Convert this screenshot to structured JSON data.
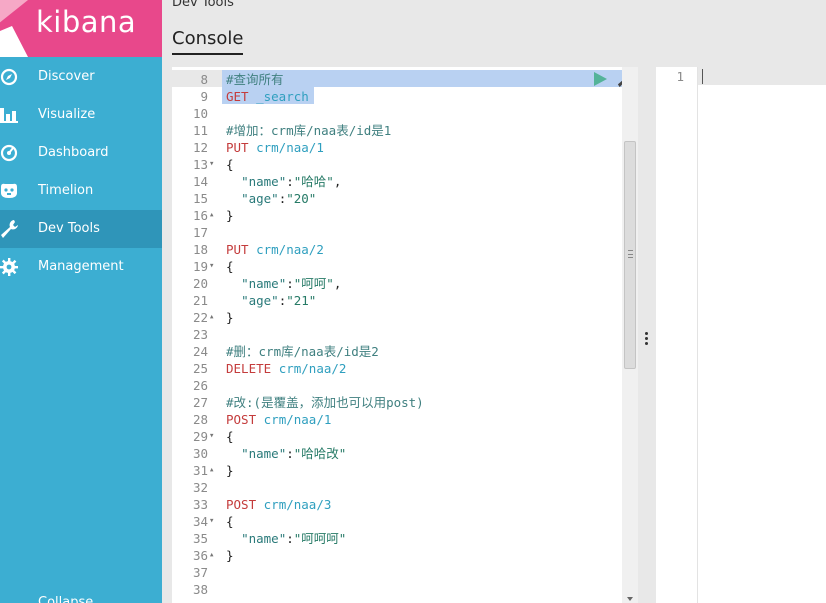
{
  "app": {
    "brand": "kibana",
    "nav": [
      {
        "label": "Discover",
        "icon": "compass-icon"
      },
      {
        "label": "Visualize",
        "icon": "bar-chart-icon"
      },
      {
        "label": "Dashboard",
        "icon": "dashboard-icon"
      },
      {
        "label": "Timelion",
        "icon": "timelion-icon"
      },
      {
        "label": "Dev Tools",
        "icon": "wrench-icon",
        "active": true
      },
      {
        "label": "Management",
        "icon": "gear-icon"
      }
    ],
    "collapse_label": "Collapse"
  },
  "header": {
    "title": "Dev Tools",
    "tab": "Console"
  },
  "editor": {
    "lines": [
      {
        "n": "8",
        "fold": "",
        "tokens": [
          {
            "t": "comment",
            "v": "#查询所有"
          }
        ]
      },
      {
        "n": "9",
        "fold": "",
        "tokens": [
          {
            "t": "method",
            "v": "GET "
          },
          {
            "t": "url",
            "v": "_search"
          }
        ]
      },
      {
        "n": "10",
        "fold": "",
        "tokens": []
      },
      {
        "n": "11",
        "fold": "",
        "tokens": [
          {
            "t": "comment",
            "v": "#增加：crm库/naa表/id是1"
          }
        ]
      },
      {
        "n": "12",
        "fold": "",
        "tokens": [
          {
            "t": "method",
            "v": "PUT "
          },
          {
            "t": "url",
            "v": "crm/naa/1"
          }
        ]
      },
      {
        "n": "13",
        "fold": "▾",
        "tokens": [
          {
            "t": "plain",
            "v": "{"
          }
        ]
      },
      {
        "n": "14",
        "fold": "",
        "tokens": [
          {
            "t": "plain",
            "v": "  "
          },
          {
            "t": "key",
            "v": "\"name\""
          },
          {
            "t": "plain",
            "v": ":"
          },
          {
            "t": "str",
            "v": "\"哈哈\""
          },
          {
            "t": "plain",
            "v": ","
          }
        ]
      },
      {
        "n": "15",
        "fold": "",
        "tokens": [
          {
            "t": "plain",
            "v": "  "
          },
          {
            "t": "key",
            "v": "\"age\""
          },
          {
            "t": "plain",
            "v": ":"
          },
          {
            "t": "str",
            "v": "\"20\""
          }
        ]
      },
      {
        "n": "16",
        "fold": "▴",
        "tokens": [
          {
            "t": "plain",
            "v": "}"
          }
        ]
      },
      {
        "n": "17",
        "fold": "",
        "tokens": []
      },
      {
        "n": "18",
        "fold": "",
        "tokens": [
          {
            "t": "method",
            "v": "PUT "
          },
          {
            "t": "url",
            "v": "crm/naa/2"
          }
        ]
      },
      {
        "n": "19",
        "fold": "▾",
        "tokens": [
          {
            "t": "plain",
            "v": "{"
          }
        ]
      },
      {
        "n": "20",
        "fold": "",
        "tokens": [
          {
            "t": "plain",
            "v": "  "
          },
          {
            "t": "key",
            "v": "\"name\""
          },
          {
            "t": "plain",
            "v": ":"
          },
          {
            "t": "str",
            "v": "\"呵呵\""
          },
          {
            "t": "plain",
            "v": ","
          }
        ]
      },
      {
        "n": "21",
        "fold": "",
        "tokens": [
          {
            "t": "plain",
            "v": "  "
          },
          {
            "t": "key",
            "v": "\"age\""
          },
          {
            "t": "plain",
            "v": ":"
          },
          {
            "t": "str",
            "v": "\"21\""
          }
        ]
      },
      {
        "n": "22",
        "fold": "▴",
        "tokens": [
          {
            "t": "plain",
            "v": "}"
          }
        ]
      },
      {
        "n": "23",
        "fold": "",
        "tokens": []
      },
      {
        "n": "24",
        "fold": "",
        "tokens": [
          {
            "t": "comment",
            "v": "#删：crm库/naa表/id是2"
          }
        ]
      },
      {
        "n": "25",
        "fold": "",
        "tokens": [
          {
            "t": "method",
            "v": "DELETE "
          },
          {
            "t": "url",
            "v": "crm/naa/2"
          }
        ]
      },
      {
        "n": "26",
        "fold": "",
        "tokens": []
      },
      {
        "n": "27",
        "fold": "",
        "tokens": [
          {
            "t": "comment",
            "v": "#改:(是覆盖，添加也可以用post)"
          }
        ]
      },
      {
        "n": "28",
        "fold": "",
        "tokens": [
          {
            "t": "method",
            "v": "POST "
          },
          {
            "t": "url",
            "v": "crm/naa/1"
          }
        ]
      },
      {
        "n": "29",
        "fold": "▾",
        "tokens": [
          {
            "t": "plain",
            "v": "{"
          }
        ]
      },
      {
        "n": "30",
        "fold": "",
        "tokens": [
          {
            "t": "plain",
            "v": "  "
          },
          {
            "t": "key",
            "v": "\"name\""
          },
          {
            "t": "plain",
            "v": ":"
          },
          {
            "t": "str",
            "v": "\"哈哈改\""
          }
        ]
      },
      {
        "n": "31",
        "fold": "▴",
        "tokens": [
          {
            "t": "plain",
            "v": "}"
          }
        ]
      },
      {
        "n": "32",
        "fold": "",
        "tokens": []
      },
      {
        "n": "33",
        "fold": "",
        "tokens": [
          {
            "t": "method",
            "v": "POST "
          },
          {
            "t": "url",
            "v": "crm/naa/3"
          }
        ]
      },
      {
        "n": "34",
        "fold": "▾",
        "tokens": [
          {
            "t": "plain",
            "v": "{"
          }
        ]
      },
      {
        "n": "35",
        "fold": "",
        "tokens": [
          {
            "t": "plain",
            "v": "  "
          },
          {
            "t": "key",
            "v": "\"name\""
          },
          {
            "t": "plain",
            "v": ":"
          },
          {
            "t": "str",
            "v": "\"呵呵呵\""
          }
        ]
      },
      {
        "n": "36",
        "fold": "▴",
        "tokens": [
          {
            "t": "plain",
            "v": "}"
          }
        ]
      },
      {
        "n": "37",
        "fold": "",
        "tokens": []
      },
      {
        "n": "38",
        "fold": "",
        "tokens": []
      }
    ]
  },
  "output": {
    "line_number": "1"
  },
  "colors": {
    "brand": "#e8488b",
    "sidebar": "#3caed2",
    "sidebar_active": "#2f95b9",
    "method": "#c43c3c",
    "url": "#2f9fbf",
    "comment": "#408080",
    "selection": "#b9d1f2",
    "play": "#54b399"
  }
}
